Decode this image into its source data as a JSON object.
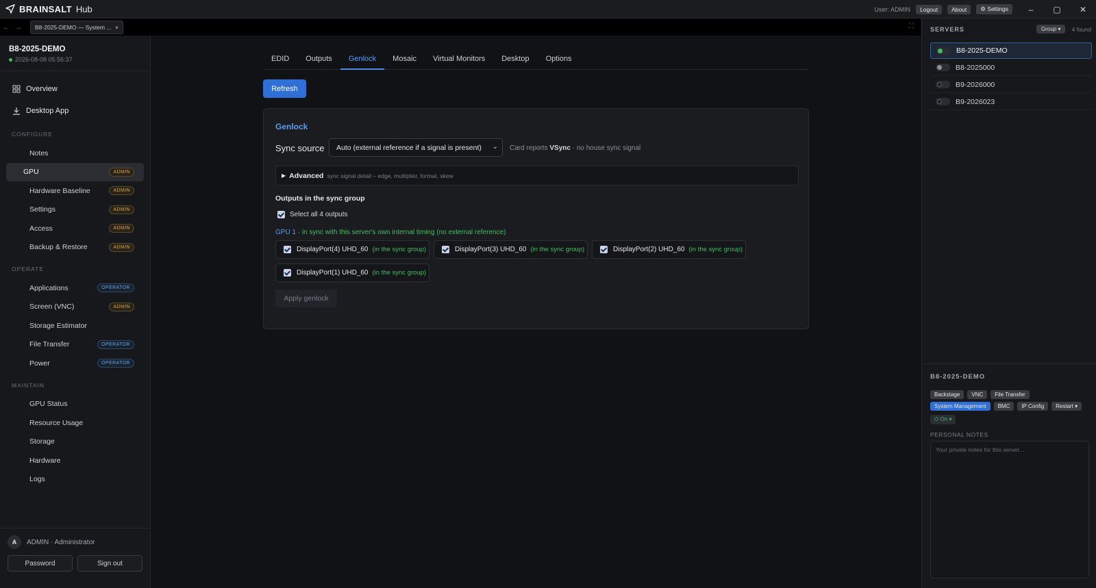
{
  "app": {
    "brand": "BRAINSALT",
    "hub": "Hub",
    "user": "User: ADMIN",
    "buttons": {
      "logout": "Logout",
      "about": "About",
      "settings": "Settings"
    },
    "window_controls": {
      "minimize": "–",
      "maximize": "▢",
      "close": "✕"
    }
  },
  "tabstrip": {
    "back": "←",
    "forward": "→",
    "doc_tab": "B8-2025-DEMO — System ...",
    "doc_tab_close": "×"
  },
  "sidebar": {
    "server_name": "B8-2025-DEMO",
    "server_date": "2026-08-08 05:56:37",
    "top_items": [
      {
        "label": "Overview"
      },
      {
        "label": "Desktop App"
      }
    ],
    "sections": [
      {
        "label": "CONFIGURE",
        "items": [
          {
            "label": "Notes",
            "badge": ""
          },
          {
            "label": "GPU",
            "badge": "ADMIN",
            "active": true
          },
          {
            "label": "Hardware Baseline",
            "badge": "ADMIN"
          },
          {
            "label": "Settings",
            "badge": "ADMIN"
          },
          {
            "label": "Access",
            "badge": "ADMIN"
          },
          {
            "label": "Backup & Restore",
            "badge": "ADMIN"
          }
        ]
      },
      {
        "label": "OPERATE",
        "items": [
          {
            "label": "Applications",
            "badge": "OPERATOR"
          },
          {
            "label": "Screen (VNC)",
            "badge": "ADMIN"
          },
          {
            "label": "Storage Estimator",
            "badge": ""
          },
          {
            "label": "File Transfer",
            "badge": "OPERATOR"
          },
          {
            "label": "Power",
            "badge": "OPERATOR"
          }
        ]
      },
      {
        "label": "MAINTAIN",
        "items": [
          {
            "label": "GPU Status",
            "badge": ""
          },
          {
            "label": "Resource Usage",
            "badge": ""
          },
          {
            "label": "Storage",
            "badge": ""
          },
          {
            "label": "Hardware",
            "badge": ""
          },
          {
            "label": "Logs",
            "badge": ""
          }
        ]
      }
    ],
    "footer": {
      "avatar": "A",
      "user": "ADMIN · Administrator",
      "password_btn": "Password",
      "signout_btn": "Sign out"
    }
  },
  "main": {
    "tabs": [
      {
        "label": "EDID"
      },
      {
        "label": "Outputs"
      },
      {
        "label": "Genlock",
        "active": true
      },
      {
        "label": "Mosaic"
      },
      {
        "label": "Virtual Monitors"
      },
      {
        "label": "Desktop"
      },
      {
        "label": "Options"
      }
    ],
    "refresh": "Refresh",
    "card": {
      "title": "Genlock",
      "sync_label": "Sync source",
      "sync_value": "Auto (external reference if a signal is present)",
      "sync_note_pre": "Card reports",
      "sync_note_bold": "VSync",
      "sync_note_post": "· no house sync signal",
      "advanced_label": "Advanced",
      "advanced_hint": "sync signal detail – edge, multiplier, format, skew",
      "outputs_title": "Outputs in the sync group",
      "select_all": "Select all 4 outputs",
      "gpu_name": "GPU 1",
      "gpu_status": "· in sync with this server's own internal timing (no external reference)",
      "ports": [
        {
          "name": "DisplayPort(4) UHD_60",
          "status": "(in the sync group)"
        },
        {
          "name": "DisplayPort(3) UHD_60",
          "status": "(in the sync group)"
        },
        {
          "name": "DisplayPort(2) UHD_60",
          "status": "(in the sync group)"
        },
        {
          "name": "DisplayPort(1) UHD_60",
          "status": "(in the sync group)"
        }
      ],
      "apply": "Apply genlock"
    }
  },
  "rightpanel": {
    "title": "SERVERS",
    "group_btn": "Group ▾",
    "found": "4 found",
    "servers": [
      {
        "name": "B8-2025-DEMO",
        "status_color": "#3fbf62",
        "active": true
      },
      {
        "name": "B8-2025000",
        "status_color": "#8e9199"
      },
      {
        "name": "B9-2026000",
        "status_color": "#2b2d33"
      },
      {
        "name": "B9-2026023",
        "status_color": "#2b2d33"
      }
    ],
    "selected_name": "B8-2025-DEMO",
    "actions_row1": [
      "Backstage",
      "VNC",
      "File Transfer"
    ],
    "actions_row2": [
      "System Management",
      "BMC",
      "IP Config",
      "Restart ▾"
    ],
    "power": "⏻ On ▾",
    "notes_label": "PERSONAL NOTES",
    "notes_placeholder": "Your private notes for this server..."
  }
}
